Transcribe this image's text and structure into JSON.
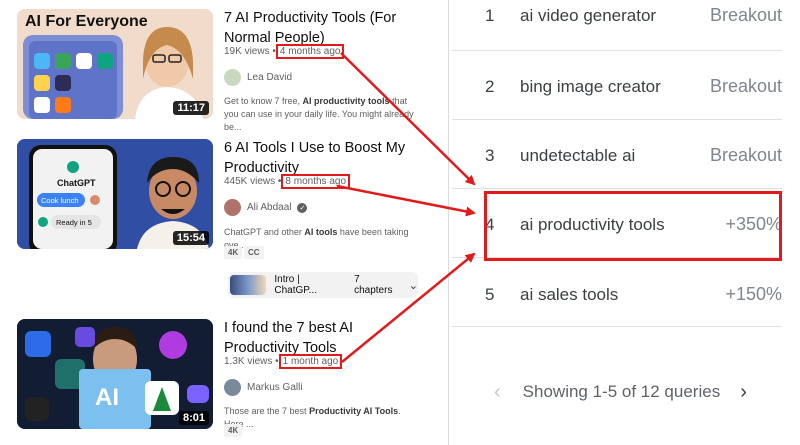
{
  "videos": [
    {
      "title": "7 AI Productivity Tools (For Normal People)",
      "views": "19K views",
      "age": "4 months ago",
      "channel": "Lea David",
      "verified": false,
      "description_pre": "Get to know 7 free, ",
      "description_bold": "AI productivity tools",
      "description_post": " that you can use in your daily life. You might already be...",
      "duration": "11:17",
      "thumb_text": "AI For Everyone",
      "tags": []
    },
    {
      "title": "6 AI Tools I Use to Boost My Productivity",
      "views": "445K views",
      "age": "8 months ago",
      "channel": "Ali Abdaal",
      "verified": true,
      "description_pre": "ChatGPT and other ",
      "description_bold": "AI tools",
      "description_post": " have been taking ove...",
      "duration": "15:54",
      "thumb_chat": [
        "ChatGPT",
        "Cook lunch",
        "Ready in 5"
      ],
      "tags": [
        "4K",
        "CC"
      ],
      "chapters": {
        "label": "Intro | ChatGP...",
        "count": "7 chapters"
      }
    },
    {
      "title": "I found the 7 best AI Productivity Tools",
      "views": "1.3K views",
      "age": "1 month ago",
      "channel": "Markus Galli",
      "verified": false,
      "description_pre": "Those are the 7 best ",
      "description_bold": "Productivity AI Tools",
      "description_post": ". Here ...",
      "duration": "8:01",
      "thumb_text": "AI",
      "tags": [
        "4K"
      ]
    }
  ],
  "trends": {
    "rows": [
      {
        "rank": "1",
        "query": "ai video generator",
        "value": "Breakout"
      },
      {
        "rank": "2",
        "query": "bing image creator",
        "value": "Breakout"
      },
      {
        "rank": "3",
        "query": "undetectable ai",
        "value": "Breakout"
      },
      {
        "rank": "4",
        "query": "ai productivity tools",
        "value": "+350%"
      },
      {
        "rank": "5",
        "query": "ai sales tools",
        "value": "+150%"
      }
    ],
    "pager_text": "Showing 1-5 of 12 queries",
    "highlight_color": "#e11b1b"
  }
}
